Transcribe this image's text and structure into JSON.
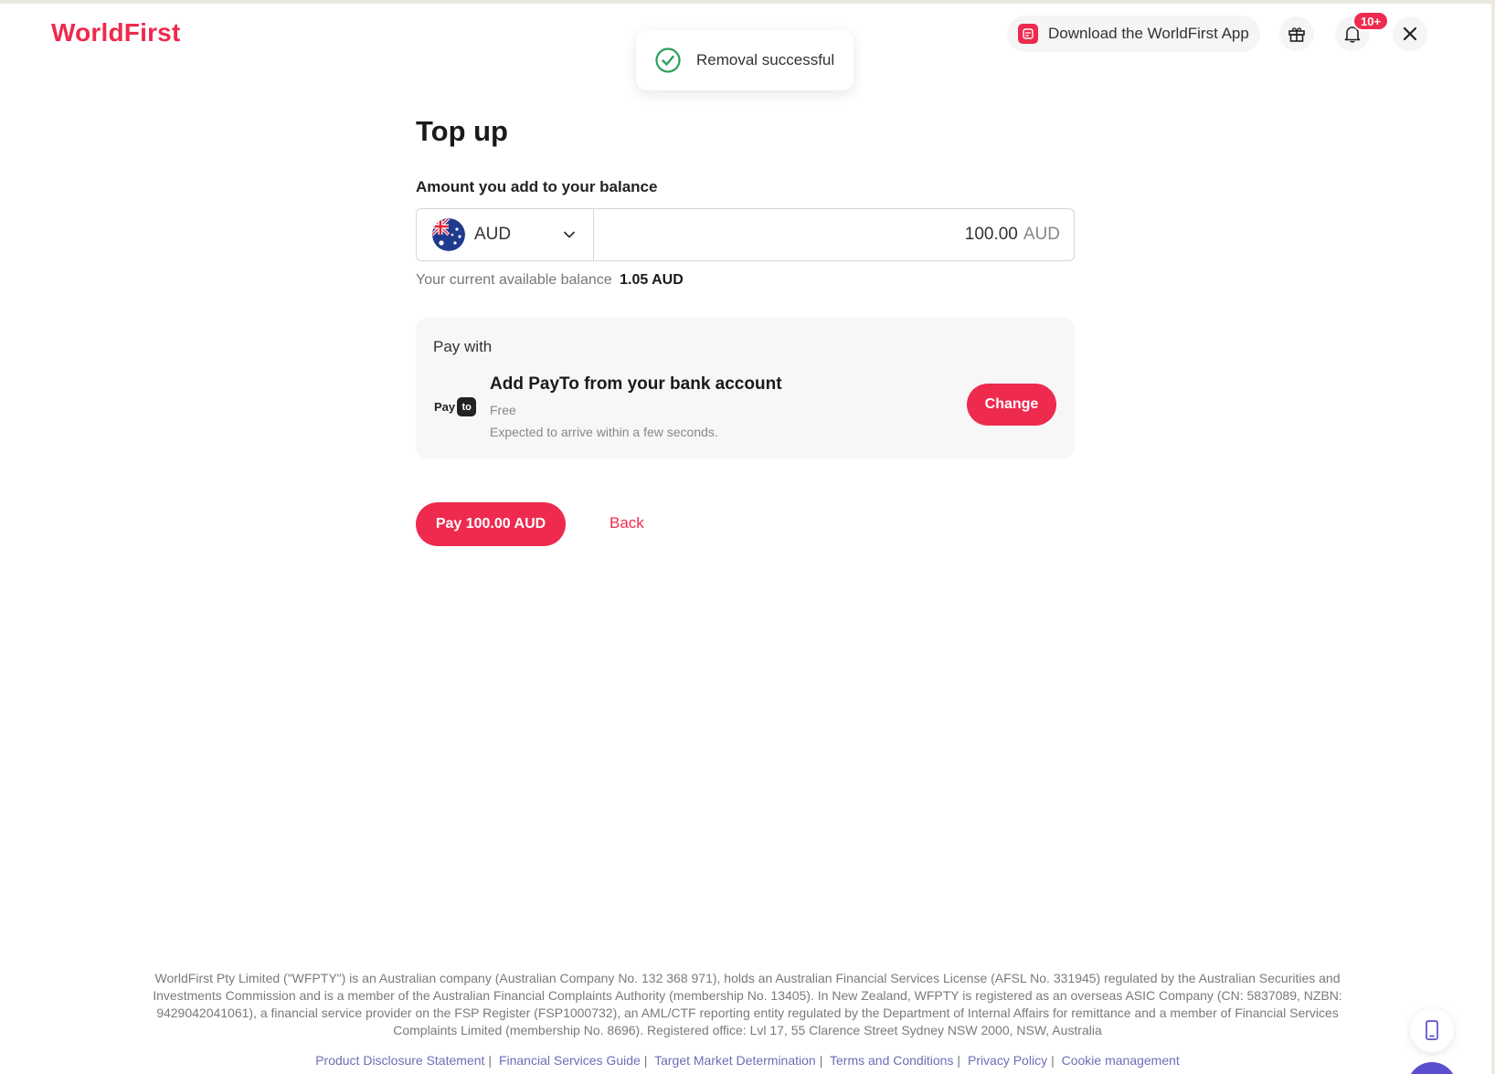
{
  "header": {
    "logo": "WorldFirst",
    "download_app_label": "Download the WorldFirst App",
    "notification_badge": "10+",
    "icons": {
      "gift": "gift-icon",
      "bell": "bell-icon",
      "close": "close-icon"
    }
  },
  "toast": {
    "message": "Removal successful",
    "icon": "check-circle-icon",
    "color": "#2e9e5b"
  },
  "main": {
    "title": "Top up",
    "amount_label": "Amount you add to your balance",
    "currency": {
      "code": "AUD",
      "flag": "australia-flag-icon"
    },
    "amount": {
      "value": "100.00",
      "unit": "AUD"
    },
    "balance": {
      "label": "Your current available balance",
      "value": "1.05 AUD"
    },
    "pay_card": {
      "heading": "Pay with",
      "logo_text": "Pay",
      "logo_badge": "to",
      "method": "Add PayTo from your bank account",
      "fee": "Free",
      "eta": "Expected to arrive within a few seconds.",
      "change_label": "Change"
    },
    "pay_button": "Pay 100.00 AUD",
    "back_link": "Back"
  },
  "footer": {
    "disclaimer": "WorldFirst Pty Limited (\"WFPTY\") is an Australian company (Australian Company No. 132 368 971), holds an Australian Financial Services License (AFSL No. 331945) regulated by the Australian Securities and Investments Commission and is a member of the Australian Financial Complaints Authority (membership No. 13405). In New Zealand, WFPTY is registered as an overseas ASIC Company (CN: 5837089, NZBN: 9429042041061), a financial service provider on the FSP Register (FSP1000732), an AML/CTF reporting entity regulated by the Department of Internal Affairs for remittance and a member of Financial Services Complaints Limited (membership No. 8696). Registered office: Lvl 17, 55 Clarence Street Sydney NSW 2000, NSW, Australia",
    "links": [
      "Product Disclosure Statement",
      "Financial Services Guide",
      "Target Market Determination",
      "Terms and Conditions",
      "Privacy Policy",
      "Cookie management"
    ]
  },
  "colors": {
    "brand": "#ee2a4e",
    "link": "#6b6fb5",
    "success": "#2e9e5b"
  }
}
